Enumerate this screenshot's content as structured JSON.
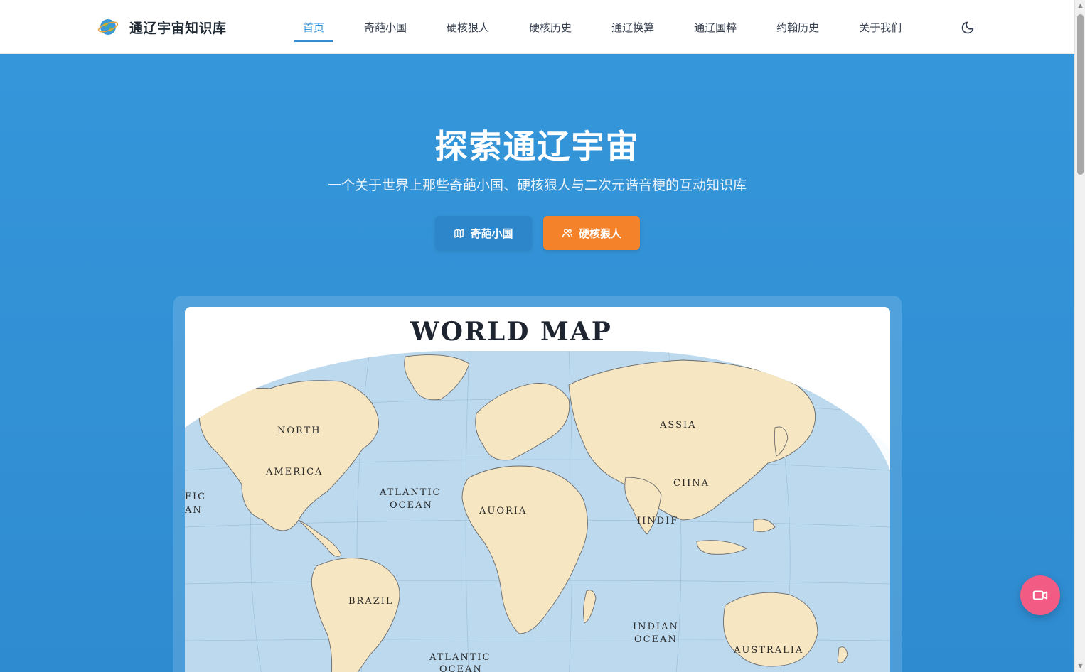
{
  "header": {
    "site_title": "通辽宇宙知识库",
    "nav": [
      {
        "label": "首页",
        "active": true
      },
      {
        "label": "奇葩小国"
      },
      {
        "label": "硬核狠人"
      },
      {
        "label": "硬核历史"
      },
      {
        "label": "通辽换算"
      },
      {
        "label": "通辽国粹"
      },
      {
        "label": "约翰历史"
      },
      {
        "label": "关于我们"
      }
    ],
    "theme_icon": "moon-icon"
  },
  "hero": {
    "title": "探索通辽宇宙",
    "subtitle": "一个关于世界上那些奇葩小国、硬核狠人与二次元谐音梗的互动知识库",
    "buttons": [
      {
        "label": "奇葩小国",
        "icon": "map-icon",
        "color": "#2d86ca"
      },
      {
        "label": "硬核狠人",
        "icon": "users-icon",
        "color": "#f4822a"
      }
    ]
  },
  "map": {
    "heading": "WORLD MAP",
    "labels": {
      "north": "NORTH",
      "america": "AMERICA",
      "pacific": "FIC",
      "pacific_ocean": "AN",
      "atlantic": "ATLANTIC",
      "atlantic_ocean": "OCEAN",
      "auoria": "AUORIA",
      "assia": "ASSIA",
      "china": "CIINA",
      "india": "IINDIF",
      "brazil": "BRAZIL",
      "indian": "INDIAN",
      "indian_ocean": "OCEAN",
      "australia": "AUSTRALIA",
      "atlantic_south": "ATLANTIC",
      "atlantic_south_ocean": "OCEAN"
    },
    "colors": {
      "land": "#f7e6c2",
      "ocean": "#bcd9ee"
    }
  },
  "fab": {
    "icon": "video-icon",
    "color": "#f25c84"
  }
}
